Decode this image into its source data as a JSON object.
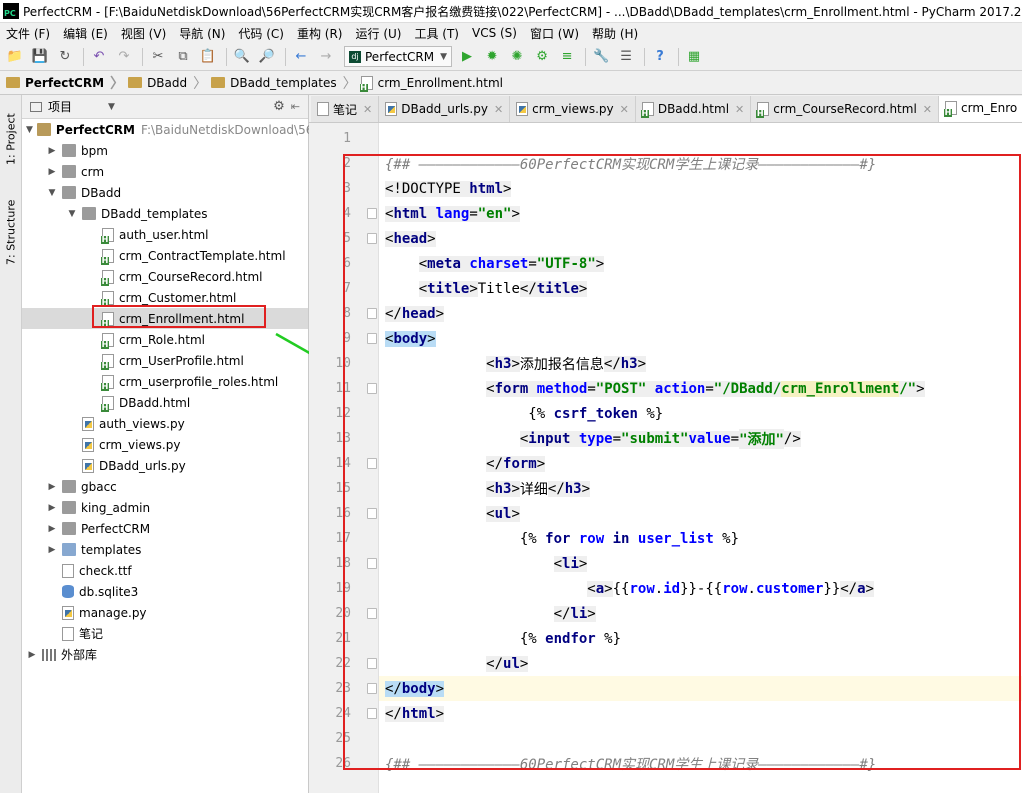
{
  "window": {
    "title": "PerfectCRM - [F:\\BaiduNetdiskDownload\\56PerfectCRM实现CRM客户报名缴费链接\\022\\PerfectCRM] - ...\\DBadd\\DBadd_templates\\crm_Enrollment.html - PyCharm 2017.2",
    "logo": "PC"
  },
  "menu": [
    "文件 (F)",
    "编辑 (E)",
    "视图 (V)",
    "导航 (N)",
    "代码 (C)",
    "重构 (R)",
    "运行 (U)",
    "工具 (T)",
    "VCS (S)",
    "窗口 (W)",
    "帮助 (H)"
  ],
  "toolbar": {
    "run_config": "PerfectCRM",
    "run_config_icon": "dj"
  },
  "breadcrumb": [
    "PerfectCRM",
    "DBadd",
    "DBadd_templates",
    "crm_Enrollment.html"
  ],
  "side_tabs": {
    "project": "1: Project",
    "structure": "7: Structure"
  },
  "project_panel": {
    "title": "项目",
    "tree": [
      {
        "label": "PerfectCRM",
        "path": "F:\\BaiduNetdiskDownload\\56",
        "indent": 0,
        "arrow": "down",
        "icon": "folder-bold",
        "bold": true
      },
      {
        "label": "bpm",
        "indent": 1,
        "arrow": "right",
        "icon": "folder"
      },
      {
        "label": "crm",
        "indent": 1,
        "arrow": "right",
        "icon": "folder"
      },
      {
        "label": "DBadd",
        "indent": 1,
        "arrow": "down",
        "icon": "folder"
      },
      {
        "label": "DBadd_templates",
        "indent": 2,
        "arrow": "down",
        "icon": "folder"
      },
      {
        "label": "auth_user.html",
        "indent": 3,
        "icon": "html"
      },
      {
        "label": "crm_ContractTemplate.html",
        "indent": 3,
        "icon": "html"
      },
      {
        "label": "crm_CourseRecord.html",
        "indent": 3,
        "icon": "html"
      },
      {
        "label": "crm_Customer.html",
        "indent": 3,
        "icon": "html"
      },
      {
        "label": "crm_Enrollment.html",
        "indent": 3,
        "icon": "html",
        "selected": true
      },
      {
        "label": "crm_Role.html",
        "indent": 3,
        "icon": "html"
      },
      {
        "label": "crm_UserProfile.html",
        "indent": 3,
        "icon": "html"
      },
      {
        "label": "crm_userprofile_roles.html",
        "indent": 3,
        "icon": "html"
      },
      {
        "label": "DBadd.html",
        "indent": 3,
        "icon": "html"
      },
      {
        "label": "auth_views.py",
        "indent": 2,
        "icon": "py"
      },
      {
        "label": "crm_views.py",
        "indent": 2,
        "icon": "py"
      },
      {
        "label": "DBadd_urls.py",
        "indent": 2,
        "icon": "py"
      },
      {
        "label": "gbacc",
        "indent": 1,
        "arrow": "right",
        "icon": "folder"
      },
      {
        "label": "king_admin",
        "indent": 1,
        "arrow": "right",
        "icon": "folder"
      },
      {
        "label": "PerfectCRM",
        "indent": 1,
        "arrow": "right",
        "icon": "folder"
      },
      {
        "label": "templates",
        "indent": 1,
        "arrow": "right",
        "icon": "folder-blue"
      },
      {
        "label": "check.ttf",
        "indent": 1,
        "icon": "ttf"
      },
      {
        "label": "db.sqlite3",
        "indent": 1,
        "icon": "db"
      },
      {
        "label": "manage.py",
        "indent": 1,
        "icon": "py"
      },
      {
        "label": "笔记",
        "indent": 1,
        "icon": "txt"
      },
      {
        "label": "外部库",
        "indent": 0,
        "arrow": "right",
        "icon": "lib"
      }
    ]
  },
  "editor_tabs": [
    {
      "label": "笔记",
      "icon": "txt"
    },
    {
      "label": "DBadd_urls.py",
      "icon": "py"
    },
    {
      "label": "crm_views.py",
      "icon": "py"
    },
    {
      "label": "DBadd.html",
      "icon": "html"
    },
    {
      "label": "crm_CourseRecord.html",
      "icon": "html"
    },
    {
      "label": "crm_Enro",
      "icon": "html",
      "active": true
    }
  ],
  "code": {
    "current_line": 23,
    "lines": [
      {
        "n": 1,
        "tokens": []
      },
      {
        "n": 2,
        "tokens": [
          {
            "t": "{## ————————————60PerfectCRM实现CRM学生上课记录————————————#}",
            "c": "c"
          }
        ]
      },
      {
        "n": 3,
        "tokens": [
          {
            "t": "<!DOCTYPE ",
            "c": "tg"
          },
          {
            "t": "html",
            "c": "t tg"
          },
          {
            "t": ">",
            "c": "tg"
          }
        ]
      },
      {
        "n": 4,
        "tokens": [
          {
            "t": "<",
            "c": "tg"
          },
          {
            "t": "html ",
            "c": "t tg"
          },
          {
            "t": "lang",
            "c": "a tg"
          },
          {
            "t": "=",
            "c": "tg"
          },
          {
            "t": "\"en\"",
            "c": "s tg"
          },
          {
            "t": ">",
            "c": "tg"
          }
        ]
      },
      {
        "n": 5,
        "tokens": [
          {
            "t": "<",
            "c": "tg"
          },
          {
            "t": "head",
            "c": "t tg"
          },
          {
            "t": ">",
            "c": "tg"
          }
        ]
      },
      {
        "n": 6,
        "tokens": [
          {
            "t": "    "
          },
          {
            "t": "<",
            "c": "tg"
          },
          {
            "t": "meta ",
            "c": "t tg"
          },
          {
            "t": "charset",
            "c": "a tg"
          },
          {
            "t": "=",
            "c": "tg"
          },
          {
            "t": "\"UTF-8\"",
            "c": "s tg"
          },
          {
            "t": ">",
            "c": "tg"
          }
        ]
      },
      {
        "n": 7,
        "tokens": [
          {
            "t": "    "
          },
          {
            "t": "<",
            "c": "tg"
          },
          {
            "t": "title",
            "c": "t tg"
          },
          {
            "t": ">",
            "c": "tg"
          },
          {
            "t": "Title"
          },
          {
            "t": "</",
            "c": "tg"
          },
          {
            "t": "title",
            "c": "t tg"
          },
          {
            "t": ">",
            "c": "tg"
          }
        ]
      },
      {
        "n": 8,
        "tokens": [
          {
            "t": "</",
            "c": "tg"
          },
          {
            "t": "head",
            "c": "t tg"
          },
          {
            "t": ">",
            "c": "tg"
          }
        ]
      },
      {
        "n": 9,
        "tokens": [
          {
            "t": "<",
            "c": "hl"
          },
          {
            "t": "body",
            "c": "t hl"
          },
          {
            "t": ">",
            "c": "hl"
          }
        ]
      },
      {
        "n": 10,
        "tokens": [
          {
            "t": "            "
          },
          {
            "t": "<",
            "c": "tg"
          },
          {
            "t": "h3",
            "c": "t tg"
          },
          {
            "t": ">",
            "c": "tg"
          },
          {
            "t": "添加报名信息"
          },
          {
            "t": "</",
            "c": "tg"
          },
          {
            "t": "h3",
            "c": "t tg"
          },
          {
            "t": ">",
            "c": "tg"
          }
        ]
      },
      {
        "n": 11,
        "tokens": [
          {
            "t": "            "
          },
          {
            "t": "<",
            "c": "tg"
          },
          {
            "t": "form ",
            "c": "t tg"
          },
          {
            "t": "method",
            "c": "a tg"
          },
          {
            "t": "=",
            "c": "tg"
          },
          {
            "t": "\"POST\" ",
            "c": "s tg"
          },
          {
            "t": "action",
            "c": "a tg"
          },
          {
            "t": "=",
            "c": "tg"
          },
          {
            "t": "\"/DBadd/",
            "c": "s tg"
          },
          {
            "t": "crm_Enrollment",
            "c": "s ylw"
          },
          {
            "t": "/\"",
            "c": "s tg"
          },
          {
            "t": ">",
            "c": "tg"
          }
        ]
      },
      {
        "n": 12,
        "tokens": [
          {
            "t": "                 "
          },
          {
            "t": "{% "
          },
          {
            "t": "csrf_token",
            "c": "t"
          },
          {
            "t": " %}"
          }
        ]
      },
      {
        "n": 13,
        "tokens": [
          {
            "t": "                "
          },
          {
            "t": "<",
            "c": "tg"
          },
          {
            "t": "input ",
            "c": "t tg"
          },
          {
            "t": "type",
            "c": "a tg"
          },
          {
            "t": "=",
            "c": "tg"
          },
          {
            "t": "\"submit\"",
            "c": "s tg"
          },
          {
            "t": "value",
            "c": "a tg"
          },
          {
            "t": "=",
            "c": "tg"
          },
          {
            "t": "\"添加\"",
            "c": "s tg"
          },
          {
            "t": "/>",
            "c": "tg"
          }
        ]
      },
      {
        "n": 14,
        "tokens": [
          {
            "t": "            "
          },
          {
            "t": "</",
            "c": "tg"
          },
          {
            "t": "form",
            "c": "t tg"
          },
          {
            "t": ">",
            "c": "tg"
          }
        ]
      },
      {
        "n": 15,
        "tokens": [
          {
            "t": "            "
          },
          {
            "t": "<",
            "c": "tg"
          },
          {
            "t": "h3",
            "c": "t tg"
          },
          {
            "t": ">",
            "c": "tg"
          },
          {
            "t": "详细"
          },
          {
            "t": "</",
            "c": "tg"
          },
          {
            "t": "h3",
            "c": "t tg"
          },
          {
            "t": ">",
            "c": "tg"
          }
        ]
      },
      {
        "n": 16,
        "tokens": [
          {
            "t": "            "
          },
          {
            "t": "<",
            "c": "tg"
          },
          {
            "t": "ul",
            "c": "t tg"
          },
          {
            "t": ">",
            "c": "tg"
          }
        ]
      },
      {
        "n": 17,
        "tokens": [
          {
            "t": "                "
          },
          {
            "t": "{% "
          },
          {
            "t": "for ",
            "c": "t"
          },
          {
            "t": "row ",
            "c": "a"
          },
          {
            "t": "in ",
            "c": "t"
          },
          {
            "t": "user_list",
            "c": "a"
          },
          {
            "t": " %}"
          }
        ]
      },
      {
        "n": 18,
        "tokens": [
          {
            "t": "                    "
          },
          {
            "t": "<",
            "c": "tg"
          },
          {
            "t": "li",
            "c": "t tg"
          },
          {
            "t": ">",
            "c": "tg"
          }
        ]
      },
      {
        "n": 19,
        "tokens": [
          {
            "t": "                        "
          },
          {
            "t": "<",
            "c": "tg"
          },
          {
            "t": "a",
            "c": "t tg"
          },
          {
            "t": ">",
            "c": "tg"
          },
          {
            "t": "{{"
          },
          {
            "t": "row",
            "c": "a"
          },
          {
            "t": "."
          },
          {
            "t": "id",
            "c": "a"
          },
          {
            "t": "}}-{{"
          },
          {
            "t": "row",
            "c": "a"
          },
          {
            "t": "."
          },
          {
            "t": "customer",
            "c": "a"
          },
          {
            "t": "}}"
          },
          {
            "t": "</",
            "c": "tg"
          },
          {
            "t": "a",
            "c": "t tg"
          },
          {
            "t": ">",
            "c": "tg"
          }
        ]
      },
      {
        "n": 20,
        "tokens": [
          {
            "t": "                    "
          },
          {
            "t": "</",
            "c": "tg"
          },
          {
            "t": "li",
            "c": "t tg"
          },
          {
            "t": ">",
            "c": "tg"
          }
        ]
      },
      {
        "n": 21,
        "tokens": [
          {
            "t": "                "
          },
          {
            "t": "{% "
          },
          {
            "t": "endfor",
            "c": "t"
          },
          {
            "t": " %}"
          }
        ]
      },
      {
        "n": 22,
        "tokens": [
          {
            "t": "            "
          },
          {
            "t": "</",
            "c": "tg"
          },
          {
            "t": "ul",
            "c": "t tg"
          },
          {
            "t": ">",
            "c": "tg"
          }
        ]
      },
      {
        "n": 23,
        "tokens": [
          {
            "t": "</",
            "c": "hl"
          },
          {
            "t": "body",
            "c": "t hl"
          },
          {
            "t": ">",
            "c": "hl"
          }
        ]
      },
      {
        "n": 24,
        "tokens": [
          {
            "t": "</",
            "c": "tg"
          },
          {
            "t": "html",
            "c": "t tg"
          },
          {
            "t": ">",
            "c": "tg"
          }
        ]
      },
      {
        "n": 25,
        "tokens": []
      },
      {
        "n": 26,
        "tokens": [
          {
            "t": "{## ————————————60PerfectCRM实现CRM学生上课记录————————————#}",
            "c": "c"
          }
        ]
      }
    ],
    "fold_lines": [
      4,
      5,
      8,
      9,
      11,
      14,
      16,
      18,
      20,
      22,
      23,
      24
    ]
  },
  "colors": {
    "annotation": "#e02020",
    "arrow": "#22cc22"
  }
}
